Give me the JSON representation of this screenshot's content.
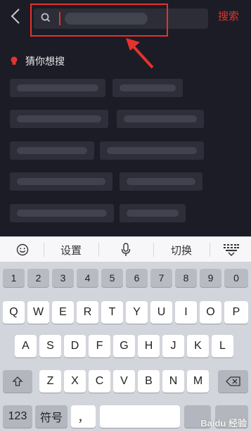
{
  "header": {
    "search_button": "搜索"
  },
  "suggestions": {
    "title": "猜你想搜"
  },
  "keyboard": {
    "toolbar": {
      "settings": "设置",
      "switch": "切换"
    },
    "numbers": [
      "1",
      "2",
      "3",
      "4",
      "5",
      "6",
      "7",
      "8",
      "9",
      "0"
    ],
    "row1": [
      "Q",
      "W",
      "E",
      "R",
      "T",
      "Y",
      "U",
      "I",
      "O",
      "P"
    ],
    "row2": [
      "A",
      "S",
      "D",
      "F",
      "G",
      "H",
      "J",
      "K",
      "L"
    ],
    "row3": [
      "Z",
      "X",
      "C",
      "V",
      "B",
      "N",
      "M"
    ],
    "bottom": {
      "num_key": "123",
      "symbol_key": "符号",
      "comma_key": "，"
    }
  },
  "watermark": "Baidu 经验",
  "colors": {
    "accent": "#e5322d",
    "background": "#1b1c25",
    "keyboard_bg": "#d2d5db"
  }
}
